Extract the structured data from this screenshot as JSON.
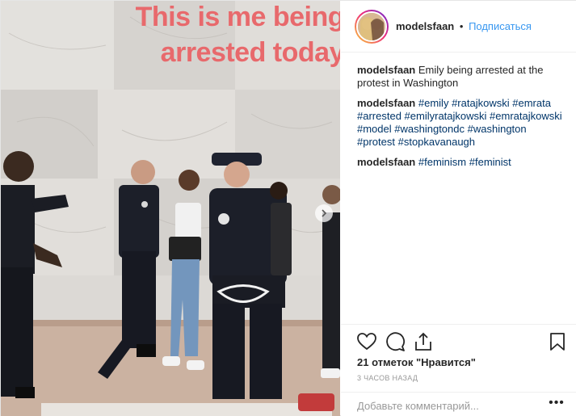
{
  "photo": {
    "overlay_line1": "This is me being",
    "overlay_line2": "arrested today"
  },
  "header": {
    "username": "modelsfaan",
    "separator": "•",
    "follow_label": "Подписаться"
  },
  "comments": [
    {
      "user": "modelsfaan",
      "text": "Emily being arrested at the protest in Washington",
      "tags": []
    },
    {
      "user": "modelsfaan",
      "text": "",
      "tags": [
        "#emily",
        "#ratajkowski",
        "#emrata",
        "#arrested",
        "#emilyratajkowski",
        "#emratajkowski",
        "#model",
        "#washingtondc",
        "#washington",
        "#protest",
        "#stopkavanaugh"
      ]
    },
    {
      "user": "modelsfaan",
      "text": "",
      "tags": [
        "#feminism",
        "#feminist"
      ]
    }
  ],
  "actions": {
    "like_icon": "heart-icon",
    "comment_icon": "comment-bubble-icon",
    "share_icon": "share-arrow-icon",
    "save_icon": "bookmark-icon"
  },
  "likes_text": "21 отметок \"Нравится\"",
  "timestamp": "3 ЧАСОВ НАЗАД",
  "add_comment": {
    "placeholder": "Добавьте комментарий...",
    "more_label": "•••"
  },
  "colors": {
    "link": "#3897f0",
    "hashtag": "#003569",
    "overlay_text": "#e8696c"
  }
}
